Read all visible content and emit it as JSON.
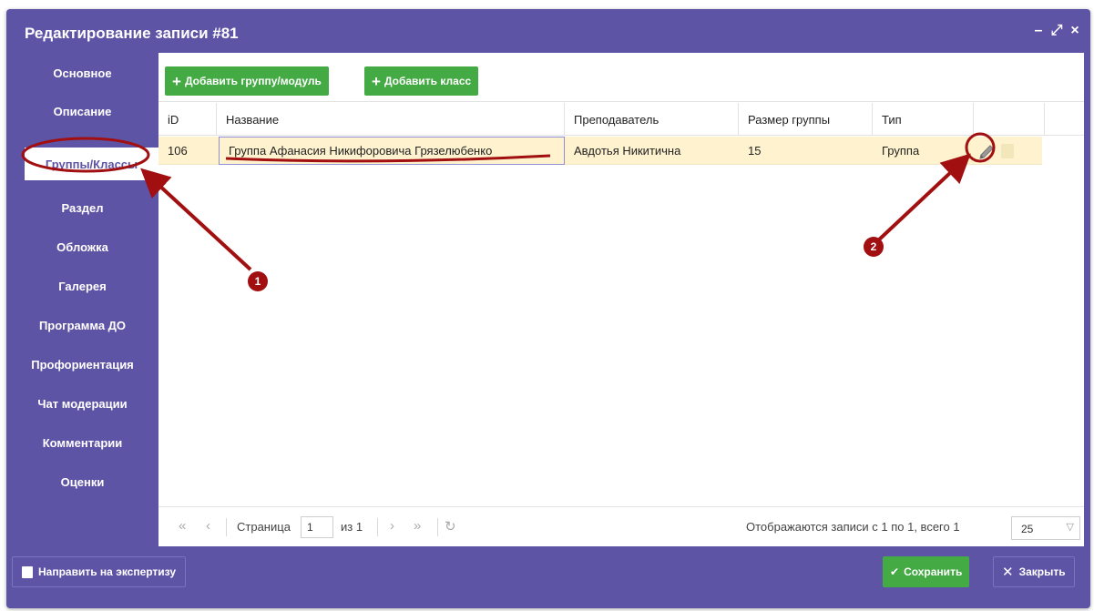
{
  "window": {
    "title": "Редактирование записи #81"
  },
  "sidebar": {
    "items": [
      {
        "label": "Основное"
      },
      {
        "label": "Описание"
      },
      {
        "label": "Группы/Классы"
      },
      {
        "label": "Раздел"
      },
      {
        "label": "Обложка"
      },
      {
        "label": "Галерея"
      },
      {
        "label": "Программа ДО"
      },
      {
        "label": "Профориентация"
      },
      {
        "label": "Чат модерации"
      },
      {
        "label": "Комментарии"
      },
      {
        "label": "Оценки"
      }
    ],
    "active_index": 2
  },
  "toolbar": {
    "add_group_label": "Добавить группу/модуль",
    "add_class_label": "Добавить класс"
  },
  "table": {
    "columns": [
      "iD",
      "Название",
      "Преподаватель",
      "Размер группы",
      "Тип"
    ],
    "rows": [
      {
        "id": "106",
        "name": "Группа Афанасия Никифоровича Грязелюбенко",
        "teacher": "Авдотья Никитична",
        "size": "15",
        "type": "Группа"
      }
    ]
  },
  "pager": {
    "page_label": "Страница",
    "page_value": "1",
    "of_label": "из 1",
    "summary": "Отображаются записи с 1 по 1, всего 1",
    "page_size": "25"
  },
  "footer": {
    "expertise_label": "Направить на экспертизу",
    "save_label": "Сохранить",
    "close_label": "Закрыть"
  },
  "annotations": {
    "badge1": "1",
    "badge2": "2",
    "color": "#a10f10"
  }
}
